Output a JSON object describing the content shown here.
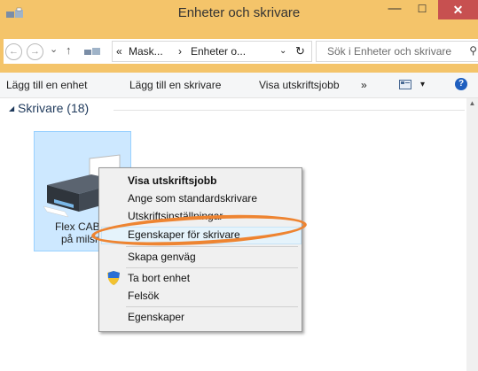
{
  "window": {
    "title": "Enheter och skrivare",
    "minimize_glyph": "—",
    "maximize_glyph": "☐",
    "close_glyph": "✕"
  },
  "nav": {
    "back_glyph": "←",
    "forward_glyph": "→",
    "recent_glyph": "⌄",
    "up_glyph": "↑",
    "breadcrumb": [
      "«",
      "Mask...",
      "›",
      "Enheter o..."
    ],
    "dropdown_glyph": "⌄",
    "refresh_glyph": "↻",
    "search_placeholder": "Sök i Enheter och skrivare",
    "search_glyph": "⚲"
  },
  "toolbar": {
    "items": [
      "Lägg till en enhet",
      "Lägg till en skrivare",
      "Visa utskriftsjobb",
      "»"
    ],
    "view_dropdown_glyph": "▾",
    "help_glyph": "?"
  },
  "group": {
    "expand_glyph": "◢",
    "label": "Skrivare (18)"
  },
  "device": {
    "name_line1": "Flex CAB E",
    "name_line2": "på milsrv"
  },
  "background_partial_text": "...............",
  "context_menu": {
    "items": [
      "Visa utskriftsjobb",
      "Ange som standardskrivare",
      "Utskriftsinställningar",
      "Egenskaper för skrivare",
      "Skapa genväg",
      "Ta bort enhet",
      "Felsök",
      "Egenskaper"
    ],
    "highlighted": "Egenskaper för skrivare"
  },
  "colors": {
    "titlebar": "#f4c46a",
    "close_button": "#c75050",
    "selection": "#cde8ff",
    "annotation": "#ee8431"
  }
}
